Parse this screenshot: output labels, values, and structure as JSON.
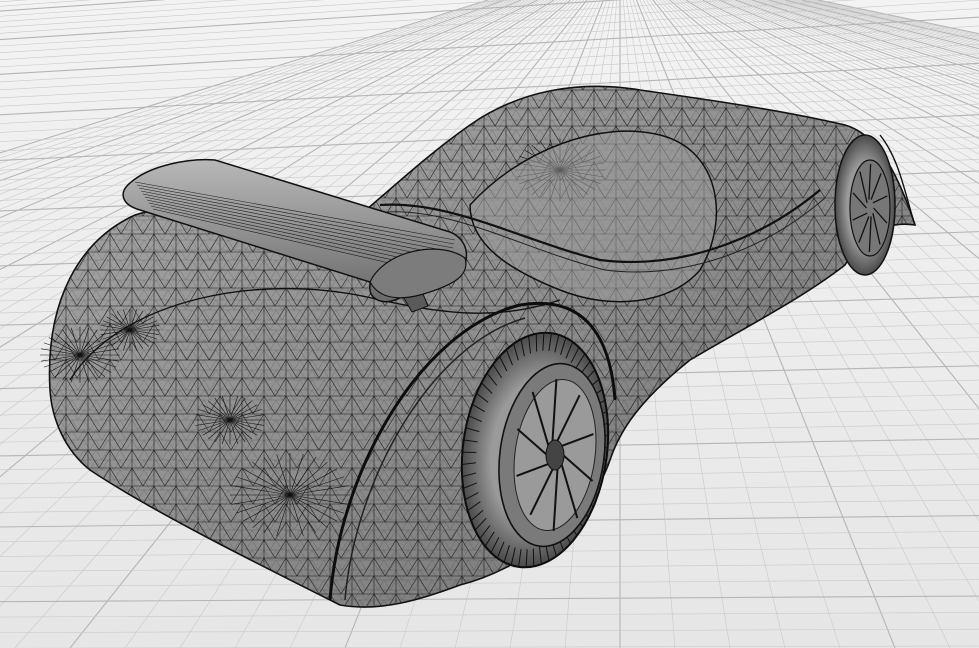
{
  "viewport": {
    "name": "perspective-viewport",
    "display_mode": "wireframe-shaded",
    "background_color": "#ececec",
    "grid_color": "#c9c9c9",
    "grid_major_color": "#b5b5b5",
    "mesh_fill_color": "#8c8c8c",
    "mesh_line_color": "#1a1a1a"
  },
  "model": {
    "type": "sports-car-concept",
    "parts": [
      "body",
      "cockpit-canopy",
      "rear-wing",
      "rear-wheel",
      "front-wheel"
    ]
  }
}
